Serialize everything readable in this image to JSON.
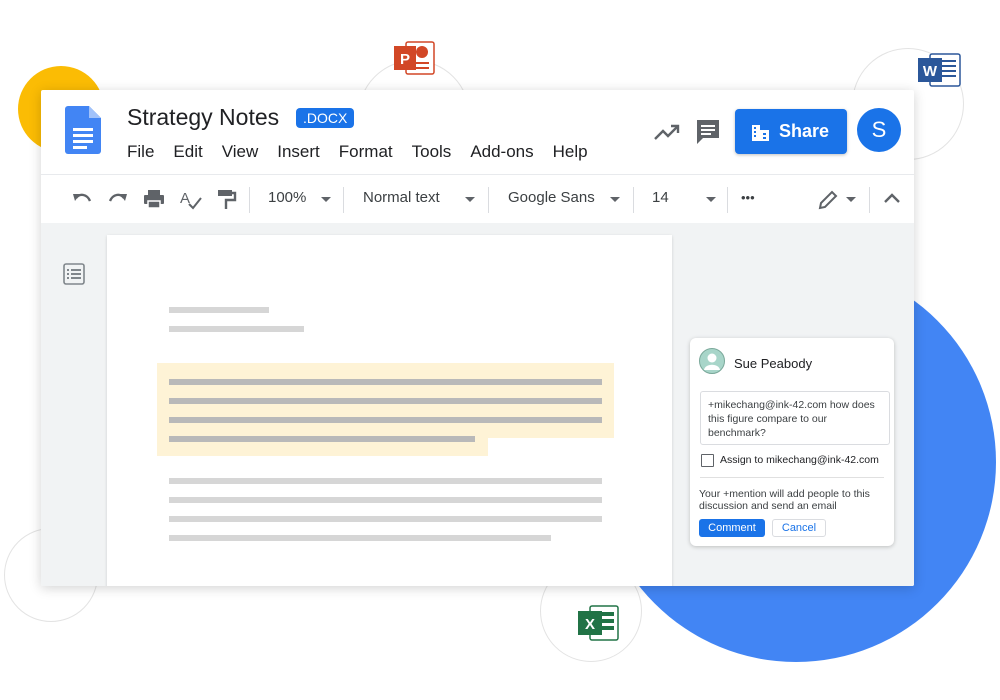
{
  "document": {
    "title": "Strategy Notes",
    "format_badge": ".DOCX"
  },
  "menu": [
    "File",
    "Edit",
    "View",
    "Insert",
    "Format",
    "Tools",
    "Add-ons",
    "Help"
  ],
  "header": {
    "share_label": "Share",
    "avatar_initial": "S"
  },
  "toolbar": {
    "zoom": "100%",
    "style": "Normal text",
    "font": "Google Sans",
    "font_size": "14",
    "more": "•••"
  },
  "comment": {
    "author": "Sue Peabody",
    "text": "+mikechang@ink-42.com how does this figure compare to our benchmark?",
    "assign_label": "Assign to mikechang@ink-42.com",
    "note": "Your +mention will add people to this discussion and send an email",
    "comment_button": "Comment",
    "cancel_button": "Cancel"
  },
  "colors": {
    "accent": "#1a73e8",
    "highlight": "#fef3d6",
    "yellow_circle": "#fbbc04",
    "blue_circle": "#4285f4",
    "powerpoint": "#d24726",
    "word": "#2b579a",
    "excel": "#217346"
  },
  "icons": [
    "powerpoint-icon",
    "word-icon",
    "excel-icon",
    "docs-logo-icon",
    "trending-icon",
    "comment-icon",
    "share-building-icon",
    "undo-icon",
    "redo-icon",
    "print-icon",
    "spellcheck-icon",
    "paint-format-icon",
    "pencil-icon",
    "chevron-up-icon",
    "outline-icon"
  ]
}
